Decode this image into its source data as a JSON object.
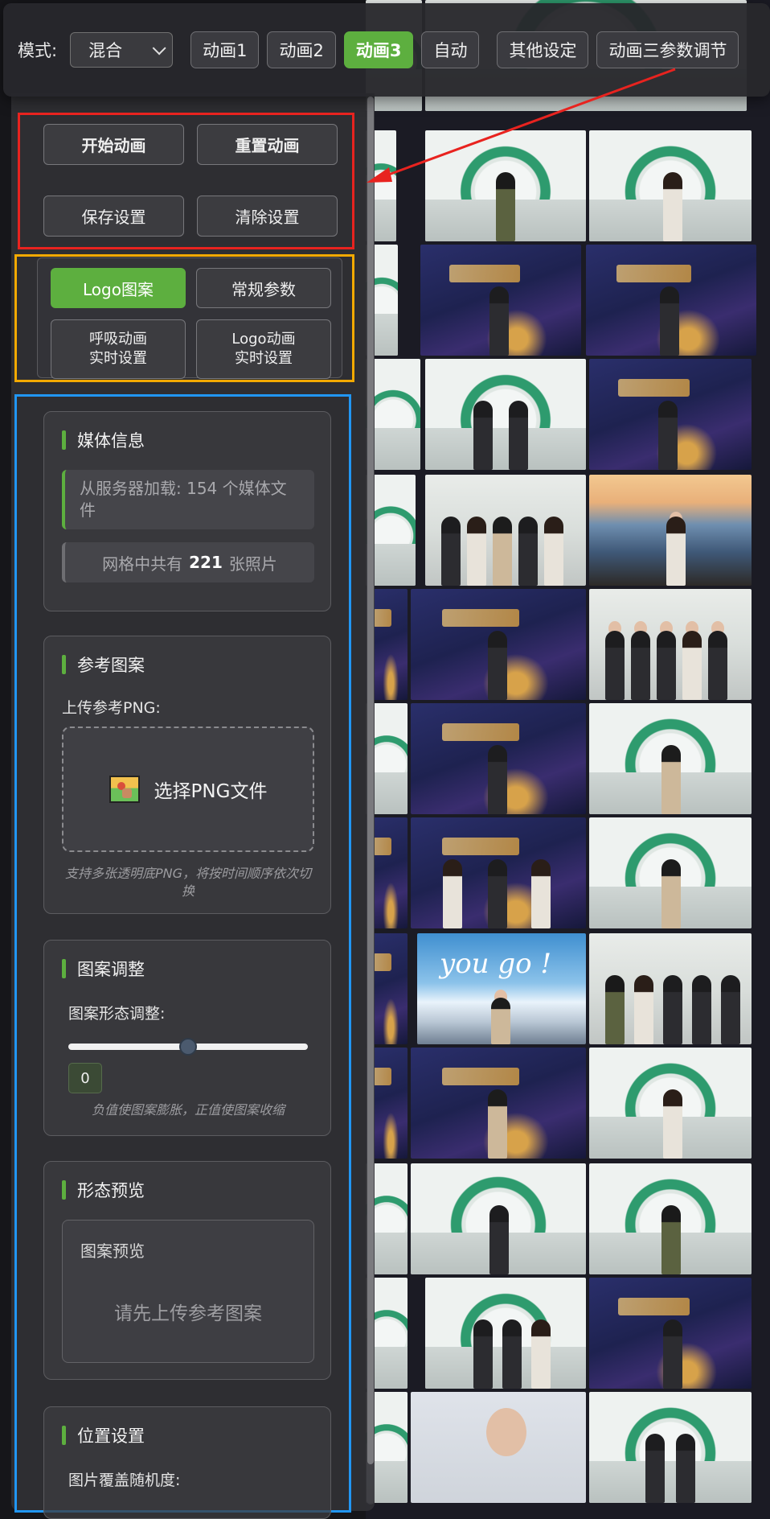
{
  "toolbar": {
    "mode_label": "模式:",
    "mode_value": "混合",
    "buttons": [
      "动画1",
      "动画2",
      "动画3",
      "自动",
      "其他设定",
      "动画三参数调节"
    ],
    "active_button": "动画3"
  },
  "controls": {
    "start": "开始动画",
    "reset": "重置动画",
    "save": "保存设置",
    "clear": "清除设置"
  },
  "tabs": {
    "logo_pattern": "Logo图案",
    "general_params": "常规参数",
    "breath_line1": "呼吸动画",
    "breath_line2": "实时设置",
    "logo_anim_line1": "Logo动画",
    "logo_anim_line2": "实时设置"
  },
  "media_info": {
    "title": "媒体信息",
    "loaded": "从服务器加载: 154 个媒体文件",
    "grid_prefix": "网格中共有",
    "grid_count": "221",
    "grid_suffix": "张照片"
  },
  "reference_pattern": {
    "title": "参考图案",
    "upload_label": "上传参考PNG:",
    "choose_file": "选择PNG文件",
    "hint": "支持多张透明底PNG，将按时间顺序依次切换"
  },
  "pattern_adjust": {
    "title": "图案调整",
    "label": "图案形态调整:",
    "value": "0",
    "slider_fraction": 0.5,
    "hint": "负值使图案膨胀，正值使图案收缩"
  },
  "shape_preview": {
    "title": "形态预览",
    "box_title": "图案预览",
    "empty_text": "请先上传参考图案"
  },
  "position_settings": {
    "title": "位置设置",
    "label": "图片覆盖随机度:"
  },
  "photo_wall": {
    "sky_tile_text": "you go !"
  },
  "colors": {
    "accent_green": "#5daf3f",
    "annotation_red": "#e8231f",
    "annotation_yellow": "#f2a900",
    "annotation_blue": "#2196f3"
  }
}
